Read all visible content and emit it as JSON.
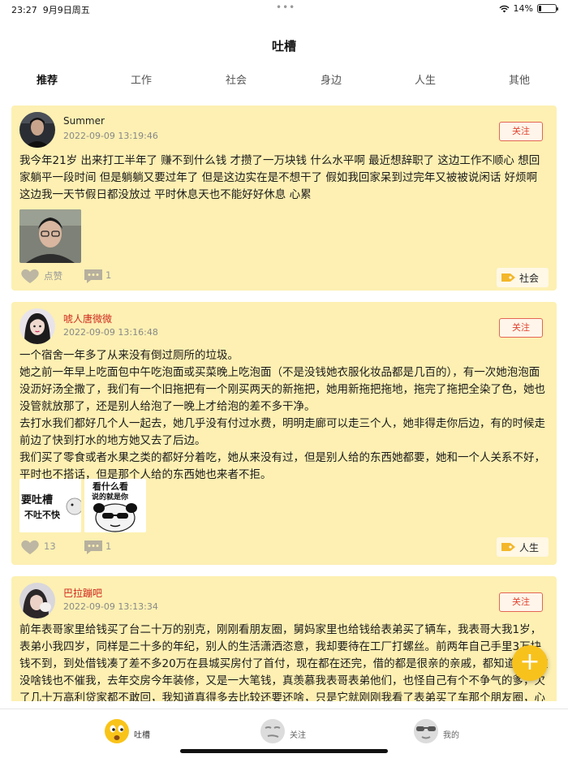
{
  "status_bar": {
    "time": "23:27",
    "date": "9月9日周五",
    "dots": "•••",
    "battery": "14%",
    "battery_level": 0.14
  },
  "header": {
    "title": "吐槽"
  },
  "tabs": [
    {
      "label": "推荐",
      "active": true
    },
    {
      "label": "工作",
      "active": false
    },
    {
      "label": "社会",
      "active": false
    },
    {
      "label": "身边",
      "active": false
    },
    {
      "label": "人生",
      "active": false
    },
    {
      "label": "其他",
      "active": false
    }
  ],
  "posts": [
    {
      "author": "Summer",
      "author_color": "#222222",
      "time": "2022-09-09 13:19:46",
      "follow_label": "关注",
      "content": "我今年21岁 出来打工半年了 赚不到什么钱 才攒了一万块钱 什么水平啊 最近想辞职了 这边工作不顺心 想回家躺平一段时间 但是躺躺又要过年了 但是这边实在是不想干了 假如我回家呆到过完年又被被说闲话 好烦啊 这边我一天节假日都没放过 平时休息天也不能好好休息 心累",
      "images": [
        "photo"
      ],
      "like_label": "点赞",
      "comment_count": "1",
      "tag": "社会"
    },
    {
      "author": "唬人唐微微",
      "author_color": "#d02a1e",
      "time": "2022-09-09 13:16:48",
      "follow_label": "关注",
      "content": "一个宿舍一年多了从来没有倒过厕所的垃圾。\n她之前一年早上吃面包中午吃泡面或买菜晚上吃泡面（不是没钱她衣服化妆品都是几百的），有一次她泡泡面没沥好汤全撒了，我们有一个旧拖把有一个刚买两天的新拖把，她用新拖把拖地，拖完了拖把全染了色，她也没管就放那了，还是别人给泡了一晚上才给泡的差不多干净。\n去打水我们都好几个人一起去，她几乎没有付过水费，明明走廊可以走三个人，她非得走你后边，有的时候走前边了快到打水的地方她又去了后边。\n我们买了零食或者水果之类的都好分着吃，她从来没有过，但是别人给的东西她都要，她和一个人关系不好，平时也不搭话，但是那个人给的东西她也来者不拒。",
      "images": [
        "meme-text",
        "meme-panda"
      ],
      "meme1_text_a": "要吐槽",
      "meme1_text_b": "不吐不快",
      "meme2_text_a": "看什么看",
      "meme2_text_b": "说的就是你",
      "like_label": "13",
      "comment_count": "1",
      "tag": "人生"
    },
    {
      "author": "巴拉蹦吧",
      "author_color": "#d02a1e",
      "time": "2022-09-09 13:13:34",
      "follow_label": "关注",
      "content": "前年表哥家里给钱买了台二十万的别克，刚刚看朋友圈，舅妈家里也给钱给表弟买了辆车，我表哥大我1岁，表弟小我四岁，同样是二十多的年纪，别人的生活潇洒恣意，我却要待在工厂打螺丝。前两年自己手里3万块钱不到，到处借钱凑了差不多20万在县城买房付了首付，现在都在还完，借的都是很亲的亲戚，都知道我现在没啥钱也不催我，去年交房今年装修，又是一大笔钱，真羡慕我表哥表弟他们，也怪自己有个不争气的爹，欠了几十万高利贷家都不敢回，我知道真得多去比较还要还啥，只是它就刚刚我看了表弟买了车那个朋友圈，心里一下就堵了。"
    }
  ],
  "fab": {
    "label": "+"
  },
  "bottom_nav": [
    {
      "label": "吐槽",
      "active": true
    },
    {
      "label": "关注",
      "active": false
    },
    {
      "label": "我的",
      "active": false
    }
  ]
}
